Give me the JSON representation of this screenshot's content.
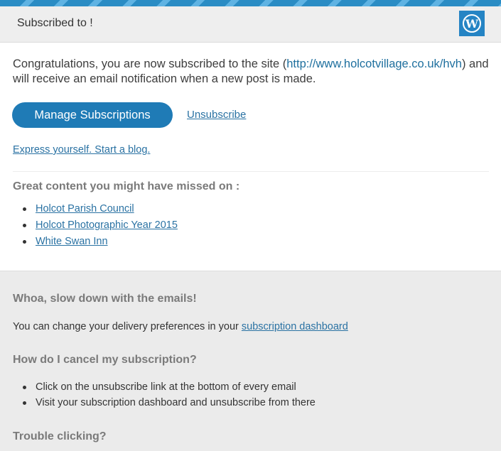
{
  "header": {
    "title": "Subscribed to !",
    "logo_icon": "wordpress-logo-icon",
    "logo_color": "#2584c4"
  },
  "intro": {
    "text_before": "Congratulations, you are now subscribed to the site (",
    "site_link": "http://www.holcotvillage.co.uk/hvh",
    "text_after": ") and will receive an email notification when a new post is made."
  },
  "actions": {
    "manage_label": "Manage Subscriptions",
    "unsubscribe_label": "Unsubscribe",
    "express_label": "Express yourself. Start a blog."
  },
  "missed": {
    "heading": "Great content you might have missed on :",
    "items": [
      "Holcot Parish Council",
      "Holcot Photographic Year 2015",
      "White Swan Inn"
    ]
  },
  "faq": {
    "slow_heading": "Whoa, slow down with the emails!",
    "slow_text": "You can change your delivery preferences in your ",
    "slow_link": "subscription dashboard",
    "cancel_heading": "How do I cancel my subscription?",
    "cancel_items": [
      "Click on the unsubscribe link at the bottom of every email",
      "Visit your subscription dashboard and unsubscribe from there"
    ],
    "trouble_heading": "Trouble clicking?"
  },
  "colors": {
    "accent": "#1f7bb6",
    "link": "#2a72a3",
    "page_bg": "#ebebeb"
  }
}
